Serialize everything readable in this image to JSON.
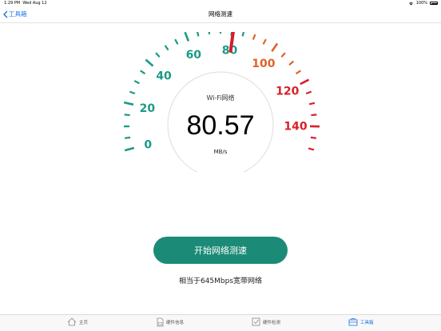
{
  "status_bar": {
    "time": "1:29 PM",
    "date": "Wed Aug 12",
    "battery": "100%"
  },
  "nav": {
    "back_label": "工具箱",
    "title": "网络测速"
  },
  "gauge": {
    "network_label": "Wi-Fi网络",
    "speed_value": "80.57",
    "unit": "MB/s",
    "speed_numeric": 80.57,
    "max": 150,
    "tick_labels": [
      "0",
      "20",
      "40",
      "60",
      "80",
      "100",
      "120",
      "140"
    ],
    "colors": {
      "teal": "#1a9a84",
      "orange": "#e0622b",
      "red": "#d8202a",
      "needle": "#d51d28"
    }
  },
  "action": {
    "start_label": "开始网络测速"
  },
  "equivalent_text": "相当于645Mbps宽带网络",
  "tabbar": {
    "items": [
      {
        "label": "主页",
        "icon": "home-icon"
      },
      {
        "label": "硬件信息",
        "icon": "sd-card-icon"
      },
      {
        "label": "硬件检测",
        "icon": "checkbox-icon"
      },
      {
        "label": "工具箱",
        "icon": "toolbox-icon",
        "active": true
      }
    ]
  }
}
